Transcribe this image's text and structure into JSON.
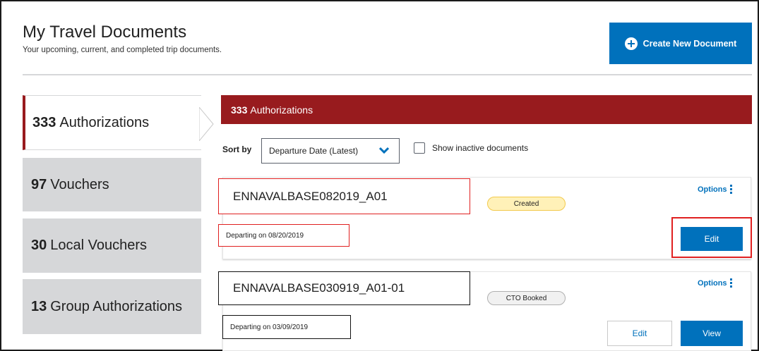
{
  "header": {
    "title": "My Travel Documents",
    "subtitle": "Your upcoming, current, and completed trip documents.",
    "create_button": "Create New Document"
  },
  "sidebar": {
    "items": [
      {
        "count": "333",
        "label": "Authorizations",
        "active": true
      },
      {
        "count": "97",
        "label": "Vouchers",
        "active": false
      },
      {
        "count": "30",
        "label": "Local Vouchers",
        "active": false
      },
      {
        "count": "13",
        "label": "Group Authorizations",
        "active": false
      }
    ]
  },
  "panel": {
    "header_count": "333",
    "header_label": "Authorizations",
    "sort_label": "Sort by",
    "sort_value": "Departure Date (Latest)",
    "show_inactive_label": "Show inactive documents",
    "show_inactive_checked": false
  },
  "documents": [
    {
      "name": "ENNAVALBASE082019_A01",
      "status": "Created",
      "departing": "Departing on 08/20/2019",
      "options_label": "Options",
      "edit_label": "Edit"
    },
    {
      "name": "ENNAVALBASE030919_A01-01",
      "status": "CTO Booked",
      "departing": "Departing on 03/09/2019",
      "options_label": "Options",
      "edit_label": "Edit",
      "view_label": "View"
    }
  ],
  "colors": {
    "primary": "#0071bc",
    "header_red": "#981b1e",
    "highlight_red": "#e02020",
    "tab_gray": "#d6d7d9",
    "badge_yellow": "#fff1b8"
  }
}
